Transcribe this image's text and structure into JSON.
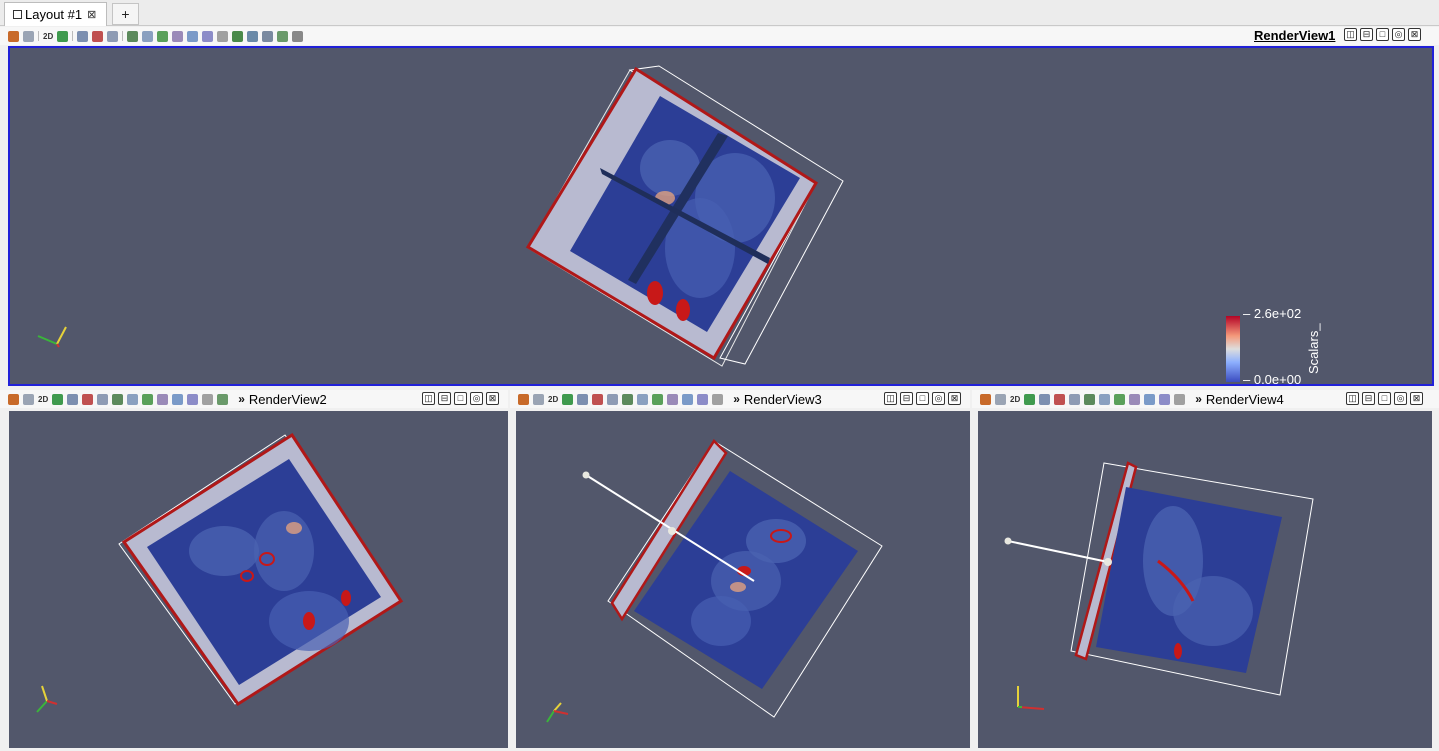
{
  "tabs": {
    "layout_tab_label": "Layout #1",
    "close_glyph": "⊠",
    "add_tab_label": "+"
  },
  "toolbar": {
    "twod_label": "2D",
    "icons": [
      "camera-link-icon",
      "camera-undo-icon",
      "2d-toggle",
      "capture-icon",
      "select-cells-icon",
      "select-points-icon",
      "select-frustum-icon",
      "select-block-icon",
      "interactive-select-icon",
      "hover-points-icon",
      "hover-cells-icon",
      "grow-selection-icon",
      "shrink-selection-icon",
      "find-data-icon",
      "clear-selection-icon"
    ],
    "chevron": "»"
  },
  "views": {
    "view1": {
      "title": "RenderView1"
    },
    "view2": {
      "title": "RenderView2"
    },
    "view3": {
      "title": "RenderView3"
    },
    "view4": {
      "title": "RenderView4"
    }
  },
  "view_buttons": [
    "split-horizontal-icon",
    "split-vertical-icon",
    "maximize-icon",
    "restore-icon",
    "close-view-icon"
  ],
  "scalar_bar": {
    "title": "Scalars_",
    "max_label": "2.6e+02",
    "min_label": "0.0e+00",
    "colormap": [
      "#b40426",
      "#f4987a",
      "#dddddd",
      "#8db0fe",
      "#3b4cc0"
    ]
  },
  "colors": {
    "background": "#52576b",
    "active_border": "#2020d8",
    "slice_blue": "#2c3e96",
    "outline_red": "#b01818"
  }
}
